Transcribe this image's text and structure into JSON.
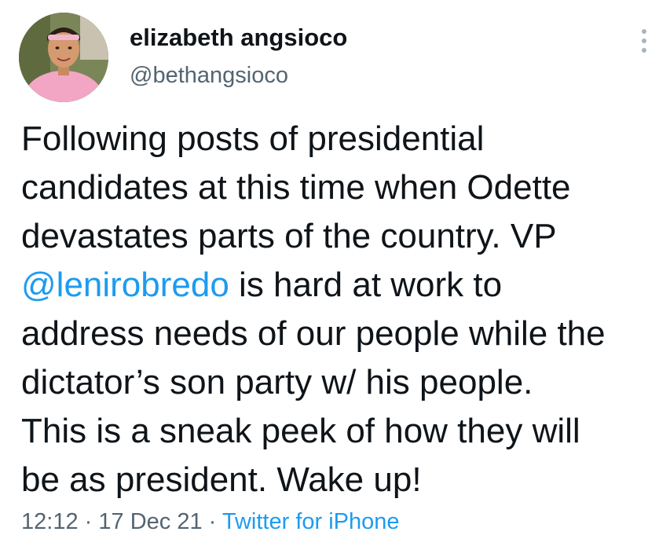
{
  "author": {
    "display_name": "elizabeth angsioco",
    "handle": "@bethangsioco"
  },
  "tweet": {
    "lines": [
      {
        "before": "Following posts of presidential",
        "mention": "",
        "after": ""
      },
      {
        "before": "candidates at this time when Odette",
        "mention": "",
        "after": ""
      },
      {
        "before": "devastates parts of the country. VP",
        "mention": "",
        "after": ""
      },
      {
        "before": "",
        "mention": "@lenirobredo",
        "after": " is hard at work to"
      },
      {
        "before": "address needs of our people while the",
        "mention": "",
        "after": ""
      },
      {
        "before": "dictator’s son party w/ his people.",
        "mention": "",
        "after": ""
      },
      {
        "before": "This is a sneak peek of how they will",
        "mention": "",
        "after": ""
      },
      {
        "before": "be as president. Wake up!",
        "mention": "",
        "after": ""
      }
    ]
  },
  "meta": {
    "time": "12:12",
    "separator": "·",
    "date": "17 Dec 21",
    "source": "Twitter for iPhone"
  },
  "icons": {
    "more": "more-vertical-icon"
  },
  "colors": {
    "text": "#0f1419",
    "secondary": "#536471",
    "accent": "#1d9bf0",
    "more_dots": "#a9b4bd"
  }
}
